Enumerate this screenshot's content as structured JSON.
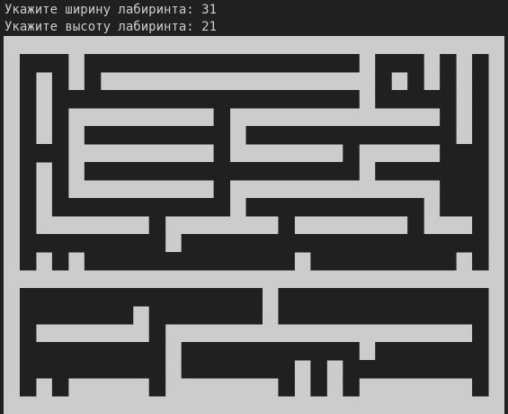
{
  "terminal": {
    "lines": [
      "Укажите ширину лабиринта: 31",
      "Укажите высоту лабиринта: 21"
    ]
  },
  "maze": {
    "width": 31,
    "height": 21,
    "colors": {
      "background": "#202020",
      "wall": "#cccccc",
      "passage": "#202020"
    },
    "grid": [
      "###############################",
      "#...#.................#...#.#.#",
      "#.#.#.#################.#.#.#.#",
      "#.#...................#.....#.#",
      "#.#.#########.#############.#.#",
      "#.#.#.........#.............#.#",
      "#...#########.#######.#####...#",
      "#.#.#.................#.......#",
      "#.#.#########.#############...#",
      "#.#...........#...........#...#",
      "#.#######.#######.#######.###.#",
      "#.........#...................#",
      "#.#.#.............#.........#.#",
      "###############################",
      "#...............#.............#",
      "#.......#.......#.............#",
      "#.#######.###################.#",
      "#.........#...........#.......#",
      "#.........#.......#.#.........#",
      "#.#.#####.#######.#.#.#######.#",
      "###############################"
    ]
  }
}
